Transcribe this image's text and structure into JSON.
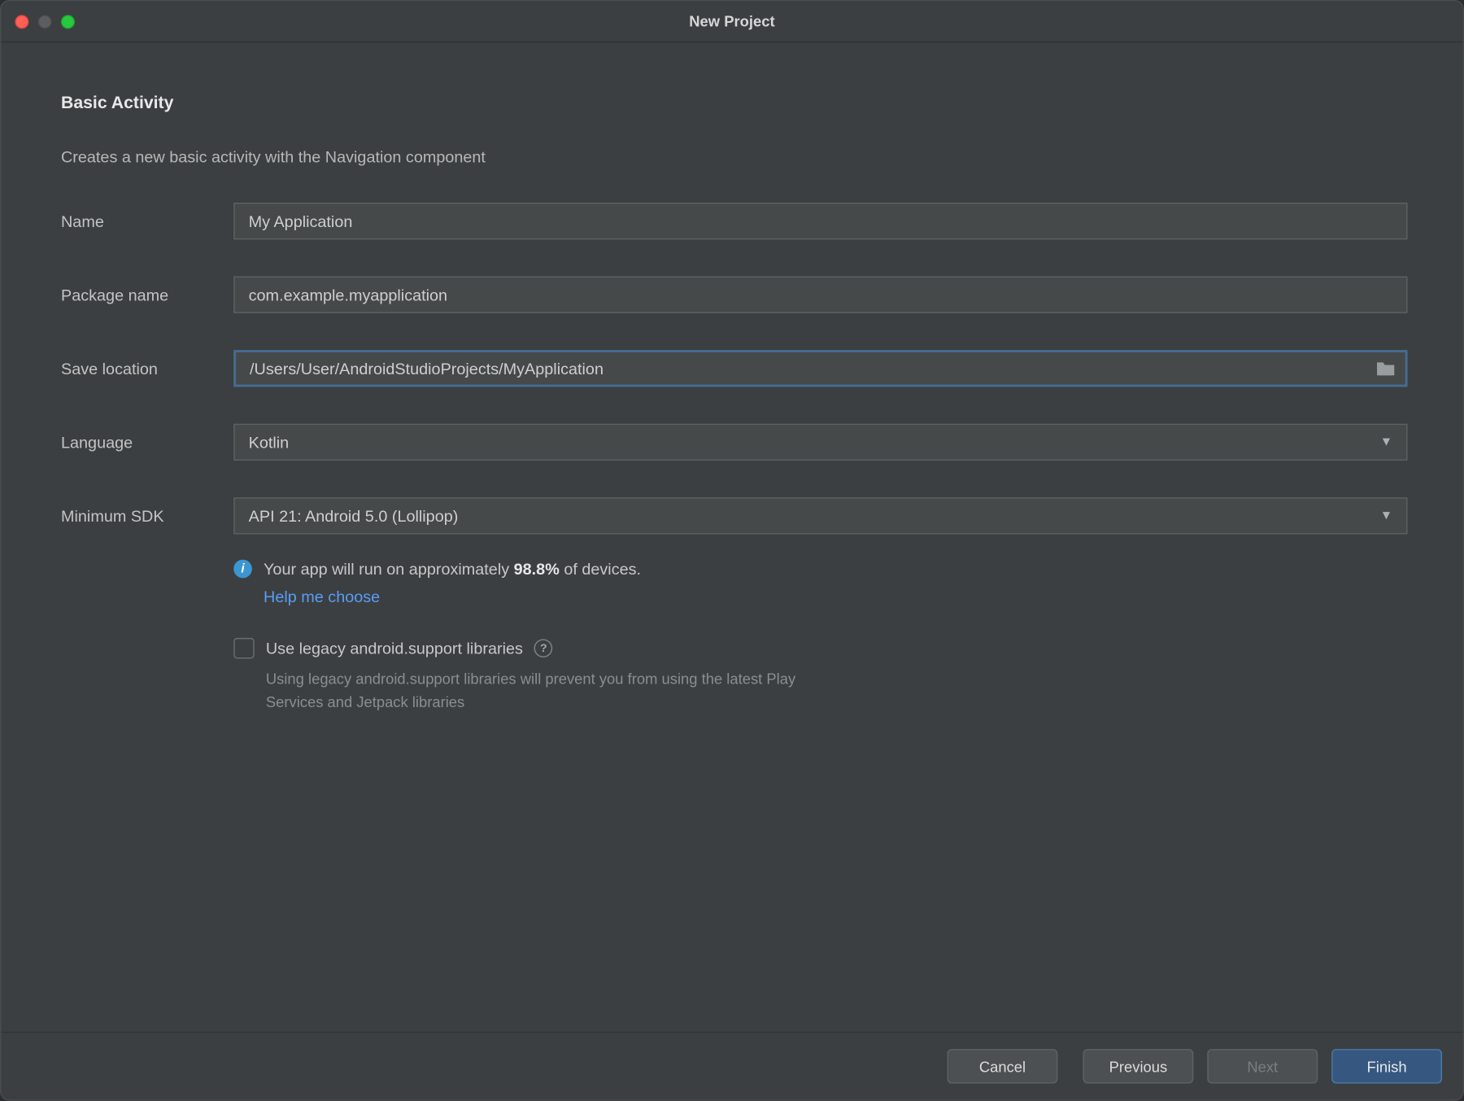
{
  "window": {
    "title": "New Project"
  },
  "header": {
    "title": "Basic Activity",
    "description": "Creates a new basic activity with the Navigation component"
  },
  "form": {
    "name": {
      "label": "Name",
      "value": "My Application"
    },
    "package": {
      "label": "Package name",
      "value": "com.example.myapplication"
    },
    "location": {
      "label": "Save location",
      "value": "/Users/User/AndroidStudioProjects/MyApplication"
    },
    "language": {
      "label": "Language",
      "value": "Kotlin"
    },
    "minsdk": {
      "label": "Minimum SDK",
      "value": "API 21: Android 5.0 (Lollipop)"
    }
  },
  "info": {
    "prefix": "Your app will run on approximately ",
    "percent": "98.8%",
    "suffix": " of devices.",
    "help_link": "Help me choose"
  },
  "legacy": {
    "label": "Use legacy android.support libraries",
    "hint": "Using legacy android.support libraries will prevent you from using the latest Play Services and Jetpack libraries"
  },
  "buttons": {
    "cancel": "Cancel",
    "previous": "Previous",
    "next": "Next",
    "finish": "Finish"
  }
}
